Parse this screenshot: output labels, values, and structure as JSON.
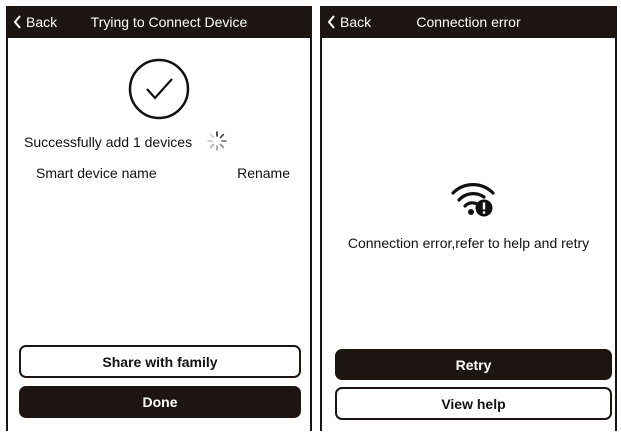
{
  "left_screen": {
    "back_label": "Back",
    "title": "Trying to Connect Device",
    "success_text": "Successfully add 1 devices",
    "device_name": "Smart device name",
    "rename_label": "Rename",
    "share_label": "Share with family",
    "done_label": "Done"
  },
  "right_screen": {
    "back_label": "Back",
    "title": "Connection error",
    "error_text": "Connection error,refer to help and retry",
    "retry_label": "Retry",
    "help_label": "View help"
  },
  "icons": {
    "back": "chevron-left-icon",
    "success": "check-circle-icon",
    "loading": "spinner-icon",
    "error": "wifi-error-icon"
  },
  "colors": {
    "dark": "#1c1512",
    "background": "#ffffff",
    "text": "#111111"
  }
}
